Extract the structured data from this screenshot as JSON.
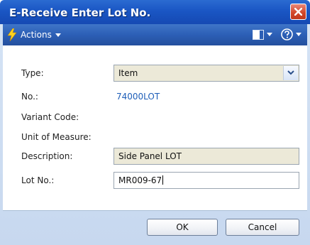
{
  "window": {
    "title": "E-Receive Enter Lot No."
  },
  "toolbar": {
    "actions_label": "Actions"
  },
  "fields": {
    "type": {
      "label": "Type:",
      "value": "Item"
    },
    "no": {
      "label": "No.:",
      "value": "74000LOT"
    },
    "variant_code": {
      "label": "Variant Code:"
    },
    "unit_of_measure": {
      "label": "Unit of Measure:"
    },
    "description": {
      "label": "Description:",
      "value": "Side Panel LOT"
    },
    "lot_no": {
      "label": "Lot No.:",
      "value": "MR009-67"
    }
  },
  "buttons": {
    "ok": "OK",
    "cancel": "Cancel"
  },
  "colors": {
    "title_bar": "#1a56c4",
    "link": "#1e5eb8",
    "close": "#d3482b"
  }
}
